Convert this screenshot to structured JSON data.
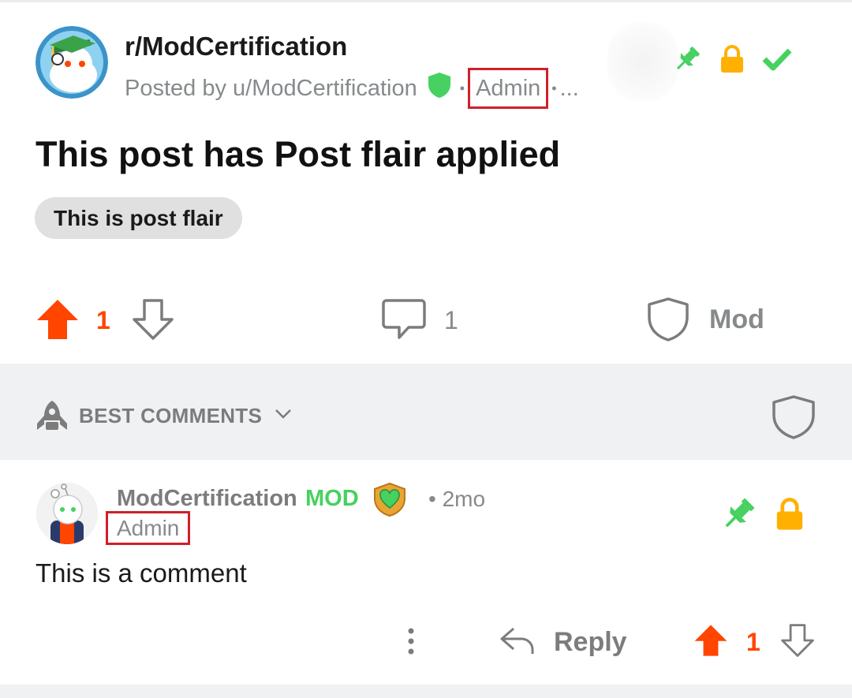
{
  "post": {
    "subreddit": "r/ModCertification",
    "posted_by": "Posted by u/ModCertification",
    "user_flair": "Admin",
    "overflow": "...",
    "title": "This post has Post flair applied",
    "post_flair": "This is post flair",
    "vote_count": "1",
    "comment_count": "1",
    "mod_label": "Mod",
    "status_icons": [
      "pin-icon",
      "lock-icon",
      "approved-check-icon"
    ]
  },
  "sort": {
    "label": "BEST COMMENTS",
    "icon": "rocket-icon"
  },
  "comment": {
    "author": "ModCertification",
    "mod_badge": "MOD",
    "time": "2mo",
    "user_flair": "Admin",
    "body": "This is a comment",
    "reply_label": "Reply",
    "vote_count": "1"
  },
  "colors": {
    "upvote": "#ff4500",
    "mod_green": "#46d160",
    "lock_yellow": "#ffb000",
    "highlight_red": "#d0202a",
    "muted_gray": "#878a8c"
  }
}
